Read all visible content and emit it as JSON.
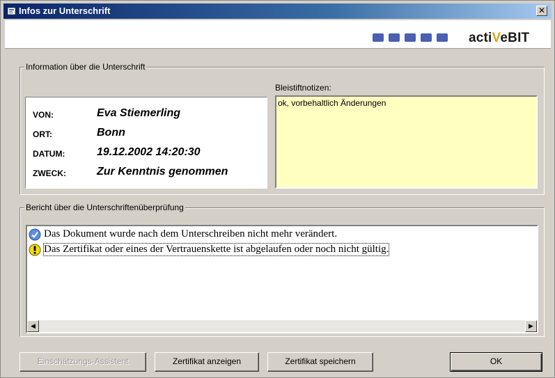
{
  "window": {
    "title": "Infos zur Unterschrift",
    "close_label": "✕"
  },
  "banner": {
    "logo_prefix": "acti",
    "logo_v": "V",
    "logo_suffix": "eBIT",
    "brand_color": "#4a5fb0"
  },
  "info_group": {
    "label": "Information über die Unterschrift",
    "fields": [
      {
        "key": "VON:",
        "value": "Eva Stiemerling"
      },
      {
        "key": "ORT:",
        "value": "Bonn"
      },
      {
        "key": "DATUM:",
        "value": "19.12.2002 14:20:30"
      },
      {
        "key": "ZWECK:",
        "value": "Zur Kenntnis genommen"
      }
    ],
    "notes_label": "Bleistiftnotizen:",
    "notes_text": "ok, vorbehaltlich Änderungen"
  },
  "report_group": {
    "label": "Bericht über die Unterschriftenüberprüfung",
    "entries": [
      {
        "icon": "check-icon",
        "text": "Das Dokument wurde nach dem Unterschreiben nicht mehr verändert."
      },
      {
        "icon": "warning-icon",
        "text": "Das Zertifikat oder eines der Vertrauenskette ist abgelaufen oder noch nicht gültig."
      }
    ]
  },
  "buttons": {
    "assistant": "Einschätzungs-Assistent",
    "show_cert": "Zertifikat anzeigen",
    "save_cert": "Zertifikat speichern",
    "ok": "OK"
  }
}
